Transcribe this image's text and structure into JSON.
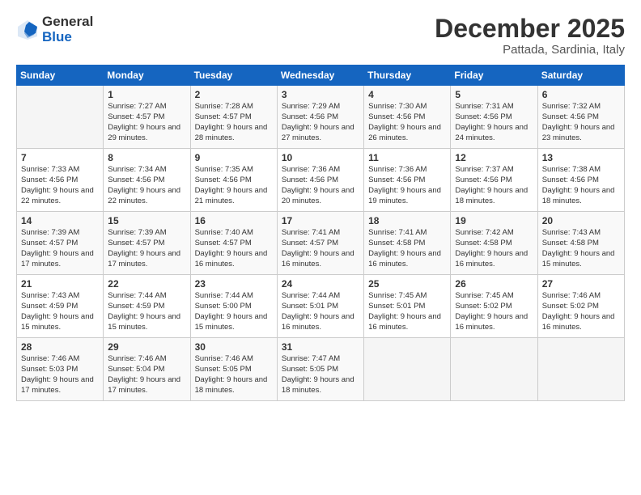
{
  "logo": {
    "general": "General",
    "blue": "Blue"
  },
  "header": {
    "month": "December 2025",
    "location": "Pattada, Sardinia, Italy"
  },
  "weekdays": [
    "Sunday",
    "Monday",
    "Tuesday",
    "Wednesday",
    "Thursday",
    "Friday",
    "Saturday"
  ],
  "weeks": [
    [
      {
        "day": "",
        "empty": true
      },
      {
        "day": "1",
        "sunrise": "7:27 AM",
        "sunset": "4:57 PM",
        "daylight": "9 hours and 29 minutes."
      },
      {
        "day": "2",
        "sunrise": "7:28 AM",
        "sunset": "4:57 PM",
        "daylight": "9 hours and 28 minutes."
      },
      {
        "day": "3",
        "sunrise": "7:29 AM",
        "sunset": "4:56 PM",
        "daylight": "9 hours and 27 minutes."
      },
      {
        "day": "4",
        "sunrise": "7:30 AM",
        "sunset": "4:56 PM",
        "daylight": "9 hours and 26 minutes."
      },
      {
        "day": "5",
        "sunrise": "7:31 AM",
        "sunset": "4:56 PM",
        "daylight": "9 hours and 24 minutes."
      },
      {
        "day": "6",
        "sunrise": "7:32 AM",
        "sunset": "4:56 PM",
        "daylight": "9 hours and 23 minutes."
      }
    ],
    [
      {
        "day": "7",
        "sunrise": "7:33 AM",
        "sunset": "4:56 PM",
        "daylight": "9 hours and 22 minutes."
      },
      {
        "day": "8",
        "sunrise": "7:34 AM",
        "sunset": "4:56 PM",
        "daylight": "9 hours and 22 minutes."
      },
      {
        "day": "9",
        "sunrise": "7:35 AM",
        "sunset": "4:56 PM",
        "daylight": "9 hours and 21 minutes."
      },
      {
        "day": "10",
        "sunrise": "7:36 AM",
        "sunset": "4:56 PM",
        "daylight": "9 hours and 20 minutes."
      },
      {
        "day": "11",
        "sunrise": "7:36 AM",
        "sunset": "4:56 PM",
        "daylight": "9 hours and 19 minutes."
      },
      {
        "day": "12",
        "sunrise": "7:37 AM",
        "sunset": "4:56 PM",
        "daylight": "9 hours and 18 minutes."
      },
      {
        "day": "13",
        "sunrise": "7:38 AM",
        "sunset": "4:56 PM",
        "daylight": "9 hours and 18 minutes."
      }
    ],
    [
      {
        "day": "14",
        "sunrise": "7:39 AM",
        "sunset": "4:57 PM",
        "daylight": "9 hours and 17 minutes."
      },
      {
        "day": "15",
        "sunrise": "7:39 AM",
        "sunset": "4:57 PM",
        "daylight": "9 hours and 17 minutes."
      },
      {
        "day": "16",
        "sunrise": "7:40 AM",
        "sunset": "4:57 PM",
        "daylight": "9 hours and 16 minutes."
      },
      {
        "day": "17",
        "sunrise": "7:41 AM",
        "sunset": "4:57 PM",
        "daylight": "9 hours and 16 minutes."
      },
      {
        "day": "18",
        "sunrise": "7:41 AM",
        "sunset": "4:58 PM",
        "daylight": "9 hours and 16 minutes."
      },
      {
        "day": "19",
        "sunrise": "7:42 AM",
        "sunset": "4:58 PM",
        "daylight": "9 hours and 16 minutes."
      },
      {
        "day": "20",
        "sunrise": "7:43 AM",
        "sunset": "4:58 PM",
        "daylight": "9 hours and 15 minutes."
      }
    ],
    [
      {
        "day": "21",
        "sunrise": "7:43 AM",
        "sunset": "4:59 PM",
        "daylight": "9 hours and 15 minutes."
      },
      {
        "day": "22",
        "sunrise": "7:44 AM",
        "sunset": "4:59 PM",
        "daylight": "9 hours and 15 minutes."
      },
      {
        "day": "23",
        "sunrise": "7:44 AM",
        "sunset": "5:00 PM",
        "daylight": "9 hours and 15 minutes."
      },
      {
        "day": "24",
        "sunrise": "7:44 AM",
        "sunset": "5:01 PM",
        "daylight": "9 hours and 16 minutes."
      },
      {
        "day": "25",
        "sunrise": "7:45 AM",
        "sunset": "5:01 PM",
        "daylight": "9 hours and 16 minutes."
      },
      {
        "day": "26",
        "sunrise": "7:45 AM",
        "sunset": "5:02 PM",
        "daylight": "9 hours and 16 minutes."
      },
      {
        "day": "27",
        "sunrise": "7:46 AM",
        "sunset": "5:02 PM",
        "daylight": "9 hours and 16 minutes."
      }
    ],
    [
      {
        "day": "28",
        "sunrise": "7:46 AM",
        "sunset": "5:03 PM",
        "daylight": "9 hours and 17 minutes."
      },
      {
        "day": "29",
        "sunrise": "7:46 AM",
        "sunset": "5:04 PM",
        "daylight": "9 hours and 17 minutes."
      },
      {
        "day": "30",
        "sunrise": "7:46 AM",
        "sunset": "5:05 PM",
        "daylight": "9 hours and 18 minutes."
      },
      {
        "day": "31",
        "sunrise": "7:47 AM",
        "sunset": "5:05 PM",
        "daylight": "9 hours and 18 minutes."
      },
      {
        "day": "",
        "empty": true
      },
      {
        "day": "",
        "empty": true
      },
      {
        "day": "",
        "empty": true
      }
    ]
  ],
  "labels": {
    "sunrise": "Sunrise:",
    "sunset": "Sunset:",
    "daylight": "Daylight:"
  }
}
